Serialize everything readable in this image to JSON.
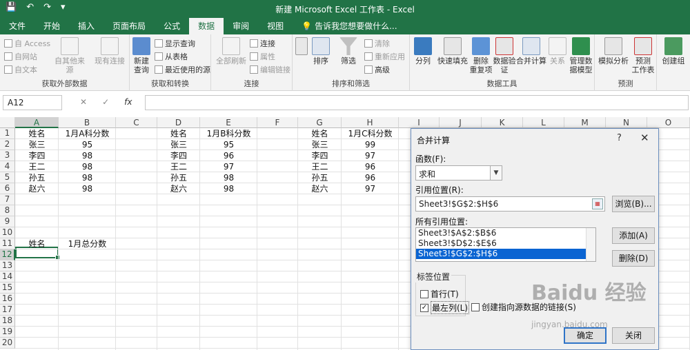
{
  "app": {
    "title": "新建 Microsoft Excel 工作表 - Excel",
    "quick_access": [
      "💾",
      "↶",
      "↷",
      "▾"
    ]
  },
  "tabs": [
    "文件",
    "开始",
    "插入",
    "页面布局",
    "公式",
    "数据",
    "审阅",
    "视图"
  ],
  "tell_me": "告诉我您想要做什么...",
  "ribbon": {
    "external": {
      "access": "自 Access",
      "web": "自网站",
      "text": "自文本",
      "other": "自其他来源",
      "existing": "现有连接",
      "group": "获取外部数据"
    },
    "transform": {
      "new_query": "新建",
      "new_query2": "查询",
      "show_query": "显示查询",
      "from_table": "从表格",
      "recent": "最近使用的源",
      "group": "获取和转换"
    },
    "connections": {
      "refresh_all": "全部刷新",
      "connections": "连接",
      "properties": "属性",
      "edit_links": "编辑链接",
      "group": "连接"
    },
    "sort_filter": {
      "sort": "排序",
      "filter": "筛选",
      "clear": "清除",
      "reapply": "重新应用",
      "advanced": "高级",
      "group": "排序和筛选"
    },
    "data_tools": {
      "text_to_cols": "分列",
      "flash_fill": "快速填充",
      "remove_dup": "删除",
      "remove_dup2": "重复项",
      "validation": "数据验",
      "validation2": "证",
      "consolidate": "合并计算",
      "relationships": "关系",
      "data_model": "管理数",
      "data_model2": "据模型",
      "group": "数据工具"
    },
    "forecast": {
      "what_if": "模拟分析",
      "forecast_sheet": "预测",
      "forecast_sheet2": "工作表",
      "group": "预测"
    },
    "outline": {
      "group_btn": "创建组"
    }
  },
  "formula_bar": {
    "name_box": "A12",
    "fx": "fx",
    "cancel": "✕",
    "enter": "✓"
  },
  "columns": [
    "A",
    "B",
    "C",
    "D",
    "E",
    "F",
    "G",
    "H",
    "I",
    "J",
    "K",
    "L",
    "M",
    "N",
    "O"
  ],
  "rows": [
    "1",
    "2",
    "3",
    "4",
    "5",
    "6",
    "7",
    "8",
    "9",
    "10",
    "11",
    "12",
    "13",
    "14",
    "15",
    "16",
    "17",
    "18",
    "19",
    "20"
  ],
  "tables": {
    "a": {
      "header": [
        "姓名",
        "1月A科分数"
      ],
      "rows": [
        [
          "张三",
          "95"
        ],
        [
          "李四",
          "98"
        ],
        [
          "王二",
          "98"
        ],
        [
          "孙五",
          "98"
        ],
        [
          "赵六",
          "98"
        ]
      ]
    },
    "d": {
      "header": [
        "姓名",
        "1月B科分数"
      ],
      "rows": [
        [
          "张三",
          "95"
        ],
        [
          "李四",
          "96"
        ],
        [
          "王二",
          "97"
        ],
        [
          "孙五",
          "98"
        ],
        [
          "赵六",
          "98"
        ]
      ]
    },
    "g": {
      "header": [
        "姓名",
        "1月C科分数"
      ],
      "rows": [
        [
          "张三",
          "99"
        ],
        [
          "李四",
          "97"
        ],
        [
          "王二",
          "96"
        ],
        [
          "孙五",
          "96"
        ],
        [
          "赵六",
          "97"
        ]
      ]
    },
    "summary_header": [
      "姓名",
      "1月总分数"
    ]
  },
  "dialog": {
    "title": "合并计算",
    "help": "?",
    "close": "✕",
    "function_label": "函数(F):",
    "function_value": "求和",
    "reference_label": "引用位置(R):",
    "reference_value": "Sheet3!$G$2:$H$6",
    "browse": "浏览(B)...",
    "all_refs_label": "所有引用位置:",
    "all_refs": [
      "Sheet3!$A$2:$B$6",
      "Sheet3!$D$2:$E$6",
      "Sheet3!$G$2:$H$6"
    ],
    "add": "添加(A)",
    "delete": "删除(D)",
    "labels_group": "标签位置",
    "top_row": "首行(T)",
    "left_col": "最左列(L)",
    "create_links": "创建指向源数据的链接(S)",
    "ok": "确定",
    "close_btn": "关闭"
  },
  "watermark": {
    "brand": "Baidu 经验",
    "url": "jingyan.baidu.com"
  }
}
